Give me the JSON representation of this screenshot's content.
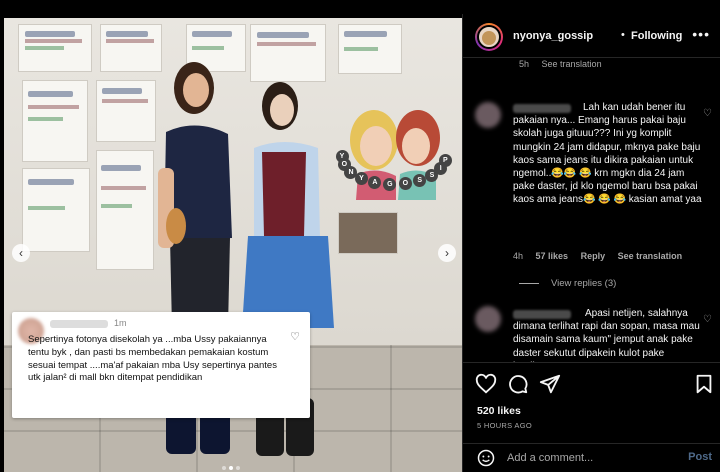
{
  "photo": {
    "overlay_comment": {
      "time": "1m",
      "text": "Sepertinya fotonya disekolah ya ...mba Ussy pakaiannya tentu byk , dan pasti bs membedakan pemakaian kostum sesuai tempat ....ma'af pakaian mba Usy sepertinya pantes utk jalan² di mall bkn ditempat pendidikan"
    },
    "sticker_letters": [
      "Y",
      "O",
      "N",
      "Y",
      "A",
      "G",
      "O",
      "S",
      "S",
      "I",
      "P"
    ],
    "carousel_index": 2,
    "carousel_count": 3
  },
  "header": {
    "username": "nyonya_gossip",
    "separator": "•",
    "follow_label": "Following",
    "more_icon": "more-horizontal-icon"
  },
  "comments": [
    {
      "meta_time": "5h",
      "meta_translate": "See translation"
    },
    {
      "text": "Lah kan udah bener itu pakaian nya... Emang harus pakai baju skolah juga gituuu??? Ini yg komplit mungkin 24 jam didapur, mknya pake baju kaos sama jeans itu dikira pakaian untuk ngemol..😂😂 😂 krn mgkn dia 24 jam pake daster, jd klo ngemol baru bsa pakai kaos ama jeans😂 😂 😂 kasian amat yaa",
      "time": "4h",
      "likes": "57 likes",
      "reply": "Reply",
      "translate": "See translation",
      "view_replies": "View replies (3)"
    },
    {
      "text": "Apasi netijen, salahnya dimana terlihat rapi dan sopan, masa mau disamain sama kaum\" jemput anak pake daster sekutut dipakein kulot pake kardigan"
    }
  ],
  "actions": {
    "like_icon": "heart-icon",
    "comment_icon": "comment-icon",
    "share_icon": "send-icon",
    "save_icon": "bookmark-icon",
    "likes": "520 likes",
    "time_ago": "5 HOURS AGO",
    "comment_placeholder": "Add a comment...",
    "post_label": "Post"
  }
}
